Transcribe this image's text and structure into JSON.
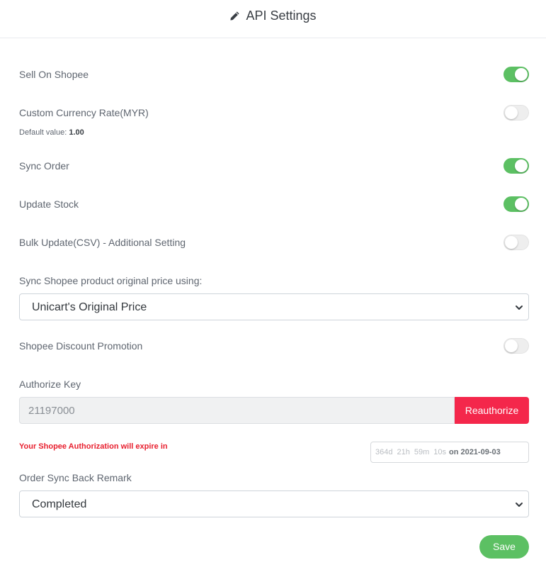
{
  "header": {
    "title": "API Settings",
    "icon": "pencil-icon"
  },
  "settings": {
    "sell_on_shopee": {
      "label": "Sell On Shopee",
      "enabled": true
    },
    "custom_currency": {
      "label": "Custom Currency Rate(MYR)",
      "enabled": false,
      "hint_prefix": "Default value:",
      "hint_value": "1.00"
    },
    "sync_order": {
      "label": "Sync Order",
      "enabled": true
    },
    "update_stock": {
      "label": "Update Stock",
      "enabled": true
    },
    "bulk_update": {
      "label": "Bulk Update(CSV) - Additional Setting",
      "enabled": false
    },
    "price_source": {
      "label": "Sync Shopee product original price using:",
      "selected": "Unicart's Original Price"
    },
    "discount_promo": {
      "label": "Shopee Discount Promotion",
      "enabled": false
    },
    "authorize": {
      "label": "Authorize Key",
      "value": "21197000",
      "button": "Reauthorize"
    },
    "expiry": {
      "warning": "Your Shopee Authorization will expire in",
      "days": "364d",
      "hours": "21h",
      "minutes": "59m",
      "seconds": "10s",
      "on_label": "on",
      "date": "2021-09-03"
    },
    "remark": {
      "label": "Order Sync Back Remark",
      "selected": "Completed"
    }
  },
  "actions": {
    "save": "Save"
  },
  "colors": {
    "toggle_on": "#5cc063",
    "danger": "#f4274b",
    "warning_text": "#e8202f"
  }
}
